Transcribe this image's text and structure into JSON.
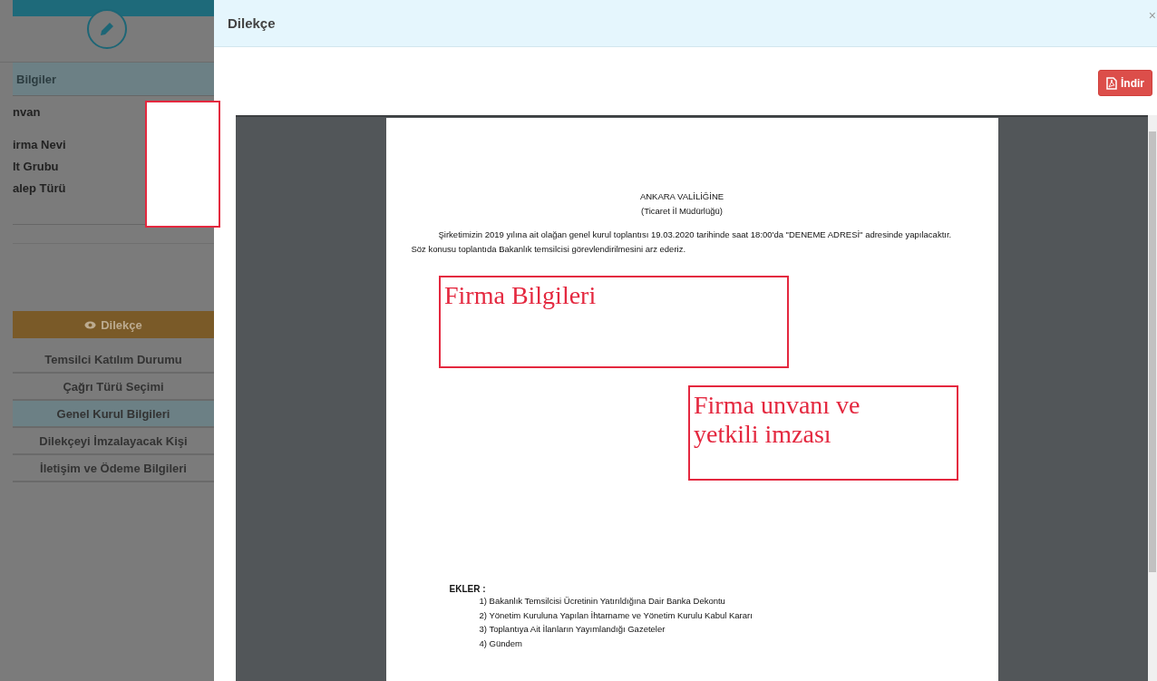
{
  "background_page": {
    "section_title": "Bilgiler",
    "fields": [
      "nvan",
      "irma Nevi",
      "lt Grubu",
      "alep Türü"
    ],
    "preview_button": "Dilekçe",
    "steps": [
      {
        "label": "Temsilci Katılım Durumu",
        "selected": false
      },
      {
        "label": "Çağrı Türü Seçimi",
        "selected": false
      },
      {
        "label": "Genel Kurul Bilgileri",
        "selected": true
      },
      {
        "label": "Dilekçeyi İmzalayacak Kişi",
        "selected": false
      },
      {
        "label": "İletişim ve Ödeme Bilgileri",
        "selected": false
      }
    ]
  },
  "modal": {
    "title": "Dilekçe",
    "close": "×",
    "download_button": "İndir",
    "document": {
      "heading": "ANKARA VALİLİĞİNE",
      "subheading": "(Ticaret İl Müdürlüğü)",
      "body": "Şirketimizin 2019 yılına ait olağan genel kurul toplantısı 19.03.2020 tarihinde saat 18:00'da \"DENEME ADRESİ\" adresinde yapılacaktır. Söz konusu toplantıda Bakanlık temsilcisi görevlendirilmesini arz ederiz.",
      "attachments_title": "EKLER :",
      "attachments": [
        "1) Bakanlık Temsilcisi Ücretinin Yatırıldığına Dair Banka Dekontu",
        "2) Yönetim Kuruluna Yapılan İhtarname ve Yönetim Kurulu Kabul Kararı",
        "3) Toplantıya Ait İlanların Yayımlandığı Gazeteler",
        "4) Gündem"
      ]
    }
  },
  "annotations": [
    {
      "kind": "blank"
    },
    {
      "kind": "label",
      "text": "Firma Bilgileri"
    },
    {
      "kind": "label",
      "text": "Firma unvanı ve yetkili imzası"
    }
  ]
}
